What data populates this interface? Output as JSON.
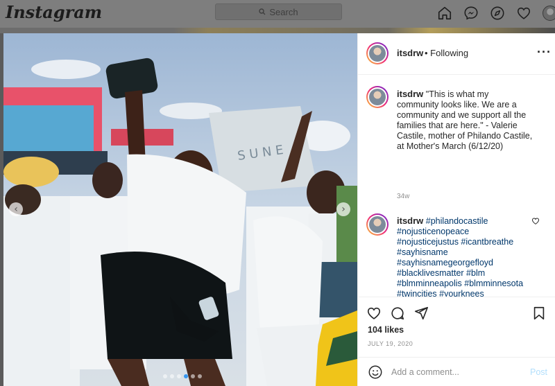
{
  "topnav": {
    "logo": "Instagram",
    "search_placeholder": "Search",
    "icons": [
      "home-icon",
      "messenger-icon",
      "explore-icon",
      "heart-icon",
      "profile-avatar"
    ]
  },
  "post": {
    "username": "itsdrw",
    "follow_status": "• Following",
    "caption_username": "itsdrw",
    "caption": "\"This is what my community looks like. We are a community and we support all the families that are here.\" - Valerie Castile, mother of Philando Castile, at Mother's March (6/12/20)",
    "caption_age": "34w",
    "comment_username": "itsdrw",
    "comment_hashtags": "#philandocastile #nojusticenopeace #nojusticejustus #icantbreathe #sayhisname #sayhisnamegeorgefloyd #blacklivesmatter #blm #blmminneapolis #blmminnesota #twincities #yourknees #blacklivesmatter🏾 #blacklivesmatter🏽🏾🏿 #minneapolis #minnesota",
    "likes": "104 likes",
    "date": "JULY 19, 2020",
    "comment_placeholder": "Add a comment...",
    "post_label": "Post",
    "carousel": {
      "slides": 6,
      "active_index": 3
    }
  },
  "colors": {
    "accent": "#3897f0",
    "link": "#00376b",
    "post_button": "#b2dffc"
  }
}
